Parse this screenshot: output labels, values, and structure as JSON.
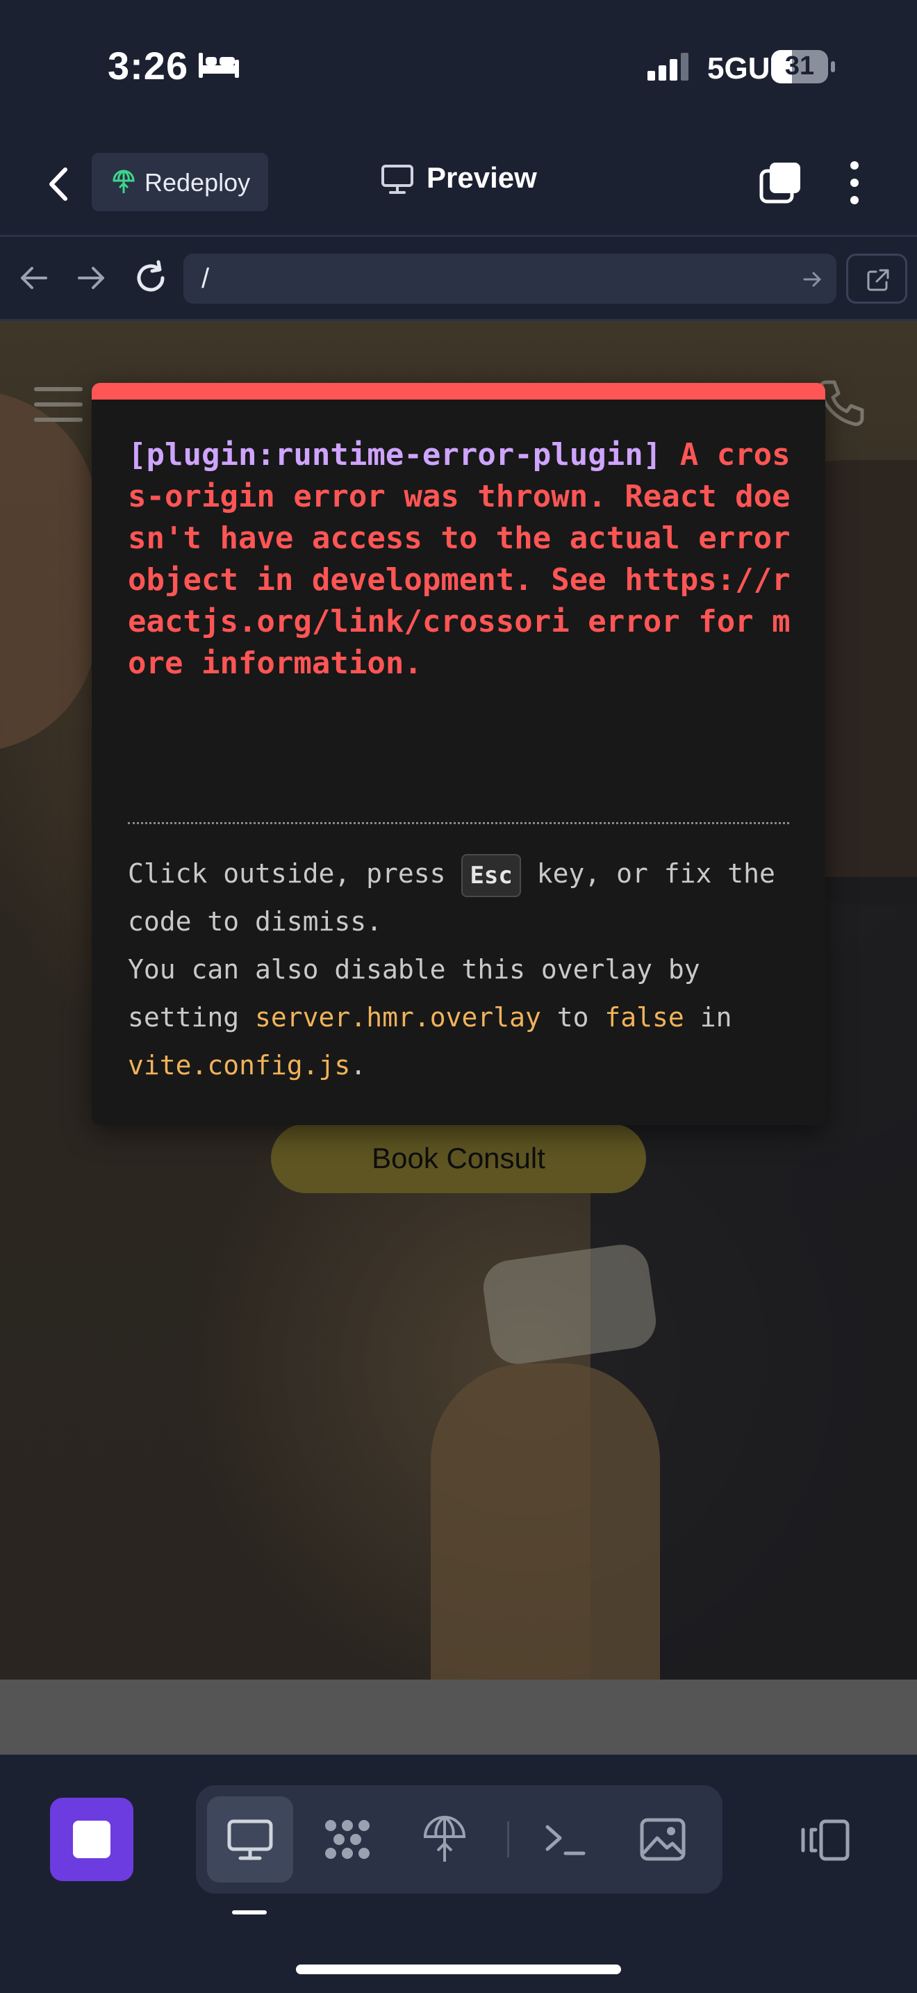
{
  "status_bar": {
    "time": "3:26",
    "network": "5GUC",
    "battery": "31",
    "icons": [
      "bed-icon",
      "signal-icon",
      "battery-icon"
    ]
  },
  "header": {
    "redeploy_label": "Redeploy",
    "title": "Preview",
    "icons": [
      "back-chevron-icon",
      "redeploy-icon",
      "monitor-icon",
      "tabs-icon",
      "more-vertical-icon"
    ]
  },
  "url_bar": {
    "url": "/",
    "icons": [
      "back-arrow-icon",
      "forward-arrow-icon",
      "reload-icon",
      "go-arrow-icon",
      "external-link-icon"
    ]
  },
  "website": {
    "book_button_label": "Book Consult",
    "icons": [
      "hamburger-menu-icon",
      "phone-icon"
    ]
  },
  "error_overlay": {
    "plugin_tag": "[plugin:runtime-error-plugin]",
    "message": " A cross-origin error was thrown. React doesn't have access to the actual error object in development. See https://reactjs.org/link/crossori error for more information.",
    "tip_1": "Click outside, press",
    "tip_key": "Esc",
    "tip_2": "key, or fix the code to dismiss.",
    "tip_3": "You can also disable this overlay by setting",
    "tip_code_1": "server.hmr.overlay",
    "tip_4": "to",
    "tip_code_2": "false",
    "tip_5": "in",
    "tip_code_3": "vite.config.js",
    "tip_6": ".",
    "colors": {
      "accent": "#ff5555",
      "plugin": "#cfa4ff",
      "code": "#f0b35a"
    }
  },
  "bottom_bar": {
    "active_tool": "preview",
    "tools": [
      "preview-icon",
      "apps-icon",
      "deploy-icon",
      "terminal-icon",
      "image-icon"
    ],
    "accent": "#6c3ce0"
  }
}
